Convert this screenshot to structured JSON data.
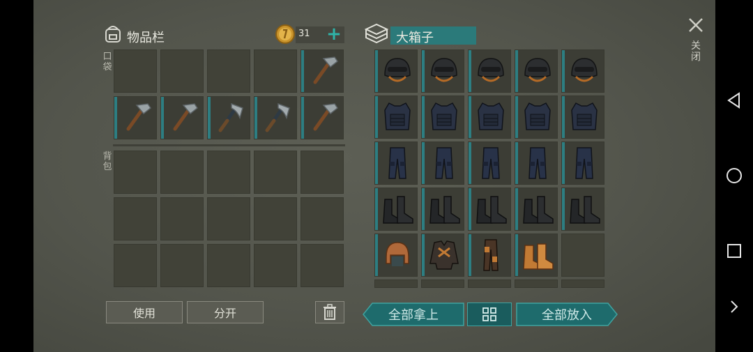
{
  "inventory": {
    "title": "物品栏",
    "coins": "31",
    "pocket_label": "口袋",
    "backpack_label": "背包",
    "pocket_slots": [
      "empty",
      "empty",
      "empty",
      "empty",
      "hammer",
      "hammer",
      "hammer",
      "axe",
      "axe",
      "hammer"
    ],
    "backpack_slots": [
      "empty",
      "empty",
      "empty",
      "empty",
      "empty",
      "empty",
      "empty",
      "empty",
      "empty",
      "empty",
      "empty",
      "empty",
      "empty",
      "empty",
      "empty"
    ],
    "use_label": "使用",
    "split_label": "分开"
  },
  "container": {
    "title": "大箱子",
    "slots": [
      "helmet",
      "helmet",
      "helmet",
      "helmet",
      "helmet",
      "vest",
      "vest",
      "vest",
      "vest",
      "vest",
      "pants",
      "pants",
      "pants",
      "pants",
      "pants",
      "boots",
      "boots",
      "boots",
      "boots",
      "boots",
      "leather-cap",
      "leather-jacket",
      "leather-pants",
      "leather-boots",
      "empty"
    ],
    "take_all_label": "全部拿上",
    "put_all_label": "全部放入"
  },
  "close_label": "关闭",
  "colors": {
    "accent": "#2d7e82",
    "button_teal": "#1e6b6c",
    "panel": "#53554c",
    "slot": "#414238"
  }
}
